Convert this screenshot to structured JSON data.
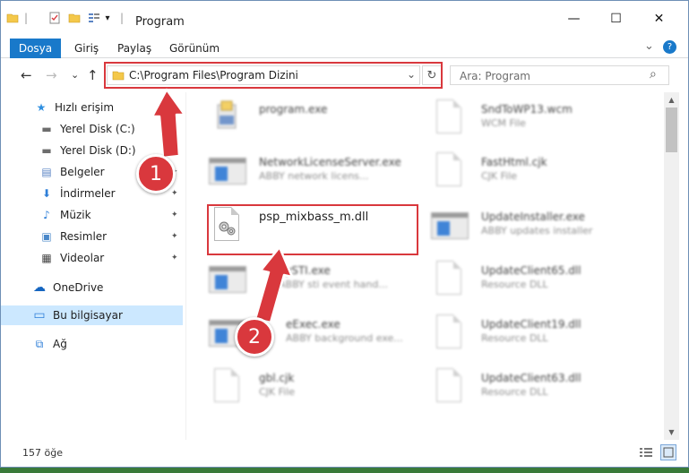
{
  "window": {
    "title": "Program",
    "minimize_glyph": "—",
    "maximize_glyph": "☐",
    "close_glyph": "✕"
  },
  "ribbon": {
    "tabs": [
      "Dosya",
      "Giriş",
      "Paylaş",
      "Görünüm"
    ],
    "expand_glyph": "⌄",
    "help_glyph": "?"
  },
  "address": {
    "path": "C:\\Program Files\\Program Dizini",
    "dropdown_glyph": "⌄",
    "refresh_glyph": "↻"
  },
  "nav": {
    "back_glyph": "←",
    "forward_glyph": "→",
    "recent_glyph": "⌄",
    "up_glyph": "↑"
  },
  "search": {
    "placeholder": "Ara: Program",
    "icon_glyph": "⌕"
  },
  "sidebar": {
    "items": [
      {
        "label": "Hızlı erişim",
        "icon": "star-icon",
        "glyph": "★",
        "pinned": false
      },
      {
        "label": "Yerel Disk (C:)",
        "icon": "drive-icon",
        "glyph": "▬",
        "pinned": true
      },
      {
        "label": "Yerel Disk (D:)",
        "icon": "drive-icon",
        "glyph": "▬",
        "pinned": true
      },
      {
        "label": "Belgeler",
        "icon": "documents-icon",
        "glyph": "▤",
        "pinned": true
      },
      {
        "label": "İndirmeler",
        "icon": "download-icon",
        "glyph": "⬇",
        "pinned": true
      },
      {
        "label": "Müzik",
        "icon": "music-icon",
        "glyph": "♪",
        "pinned": true
      },
      {
        "label": "Resimler",
        "icon": "pictures-icon",
        "glyph": "▣",
        "pinned": true
      },
      {
        "label": "Videolar",
        "icon": "videos-icon",
        "glyph": "▦",
        "pinned": true
      },
      {
        "label": "OneDrive",
        "icon": "cloud-icon",
        "glyph": "☁",
        "pinned": false
      },
      {
        "label": "Bu bilgisayar",
        "icon": "computer-icon",
        "glyph": "▭",
        "pinned": false
      },
      {
        "label": "Ağ",
        "icon": "network-icon",
        "glyph": "⧉",
        "pinned": false
      }
    ],
    "pin_glyph": "✦"
  },
  "files": [
    {
      "name": "program.exe",
      "desc": "",
      "icon": "installer-icon"
    },
    {
      "name": "SndToWP13.wcm",
      "desc": "WCM File",
      "icon": "file-icon"
    },
    {
      "name": "NetworkLicenseServer.exe",
      "desc": "ABBY network licens...",
      "icon": "exe-icon"
    },
    {
      "name": "FastHtml.cjk",
      "desc": "CJK File",
      "icon": "file-icon"
    },
    {
      "name": "psp_mixbass_m.dll",
      "desc": "",
      "icon": "dll-icon"
    },
    {
      "name": "UpdateInstaller.exe",
      "desc": "ABBY updates installer",
      "icon": "exe-icon"
    },
    {
      "name": "yySTI.exe",
      "desc": "ABBY sti event hand...",
      "icon": "exe-icon"
    },
    {
      "name": "UpdateClient65.dll",
      "desc": "Resource DLL",
      "icon": "dll-icon"
    },
    {
      "name": "eExec.exe",
      "desc": "ABBY background exe...",
      "icon": "exe-icon"
    },
    {
      "name": "UpdateClient19.dll",
      "desc": "Resource DLL",
      "icon": "dll-icon"
    },
    {
      "name": "gbl.cjk",
      "desc": "CJK File",
      "icon": "file-icon"
    },
    {
      "name": "UpdateClient63.dll",
      "desc": "Resource DLL",
      "icon": "dll-icon"
    }
  ],
  "status": {
    "count": "157 öğe"
  },
  "callouts": {
    "step1": "1",
    "step2": "2"
  },
  "colors": {
    "accent": "#1979ca",
    "highlight": "#d9383d",
    "selected": "#cce8ff"
  }
}
